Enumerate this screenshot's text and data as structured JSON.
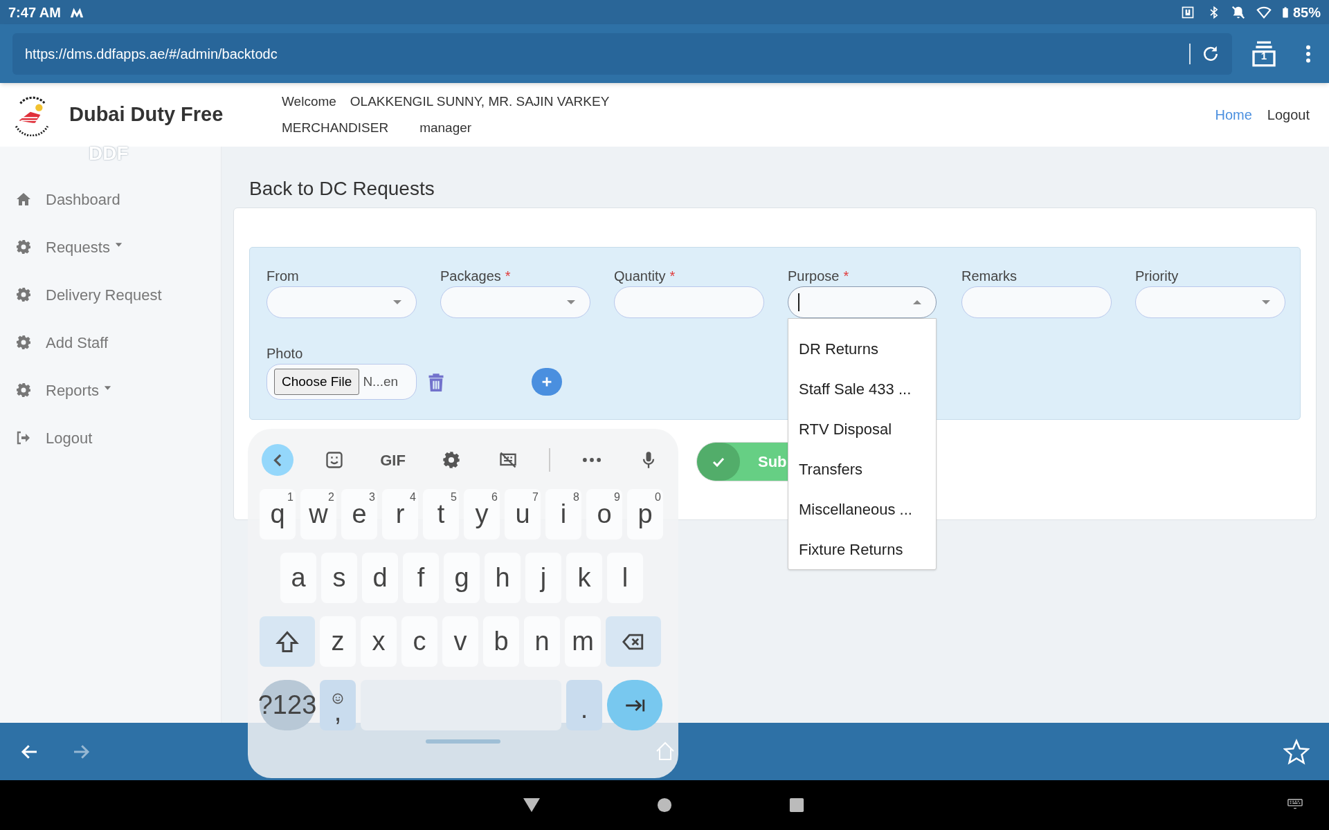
{
  "status_bar": {
    "time": "7:47 AM",
    "battery": "85%"
  },
  "browser": {
    "url": "https://dms.ddfapps.ae/#/admin/backtodc",
    "tab_count": "1"
  },
  "header": {
    "brand": "Dubai Duty Free",
    "brand_caption": "DDF",
    "welcome_label": "Welcome",
    "user_name": "OLAKKENGIL SUNNY, MR. SAJIN VARKEY",
    "role": "MERCHANDISER",
    "user_type": "manager",
    "nav": [
      {
        "label": "Home",
        "selected": true
      },
      {
        "label": "Logout",
        "selected": false
      }
    ]
  },
  "sidebar": {
    "items": [
      {
        "label": "Dashboard",
        "kind": "home",
        "has_submenu": false
      },
      {
        "label": "Requests",
        "kind": "gear",
        "has_submenu": true
      },
      {
        "label": "Delivery Request",
        "kind": "gear",
        "has_submenu": false
      },
      {
        "label": "Add Staff",
        "kind": "gear",
        "has_submenu": false
      },
      {
        "label": "Reports",
        "kind": "gear",
        "has_submenu": true
      },
      {
        "label": "Logout",
        "kind": "logout",
        "has_submenu": false
      }
    ]
  },
  "page": {
    "title": "Back to DC Requests"
  },
  "form": {
    "required_mark": "*",
    "fields": [
      {
        "label": "From",
        "required": false,
        "kind": "select",
        "open": false
      },
      {
        "label": "Packages",
        "required": true,
        "kind": "select",
        "open": false
      },
      {
        "label": "Quantity",
        "required": true,
        "kind": "input",
        "open": false
      },
      {
        "label": "Purpose",
        "required": true,
        "kind": "select",
        "open": true,
        "options": [
          "DR Returns",
          "Staff Sale 433 ...",
          "RTV Disposal",
          "Transfers",
          "Miscellaneous ...",
          "Fixture Returns"
        ]
      },
      {
        "label": "Remarks",
        "required": false,
        "kind": "input",
        "open": false
      },
      {
        "label": "Priority",
        "required": false,
        "kind": "select",
        "open": false
      }
    ],
    "photo": {
      "label": "Photo",
      "button": "Choose File",
      "file_name": "N...en"
    },
    "submit": "Sub"
  },
  "keyboard": {
    "toolbar": [
      {
        "kind": "back"
      },
      {
        "kind": "sticker"
      },
      {
        "kind": "gif",
        "label": "GIF"
      },
      {
        "kind": "settings"
      },
      {
        "kind": "floating"
      },
      {
        "kind": "separator"
      },
      {
        "kind": "more"
      },
      {
        "kind": "mic"
      }
    ],
    "rows": [
      {
        "keys": [
          {
            "kind": "letter",
            "label": "q",
            "hint": "1"
          },
          {
            "kind": "letter",
            "label": "w",
            "hint": "2"
          },
          {
            "kind": "letter",
            "label": "e",
            "hint": "3"
          },
          {
            "kind": "letter",
            "label": "r",
            "hint": "4"
          },
          {
            "kind": "letter",
            "label": "t",
            "hint": "5"
          },
          {
            "kind": "letter",
            "label": "y",
            "hint": "6"
          },
          {
            "kind": "letter",
            "label": "u",
            "hint": "7"
          },
          {
            "kind": "letter",
            "label": "i",
            "hint": "8"
          },
          {
            "kind": "letter",
            "label": "o",
            "hint": "9"
          },
          {
            "kind": "letter",
            "label": "p",
            "hint": "0"
          }
        ]
      },
      {
        "keys": [
          {
            "kind": "letter",
            "label": "a"
          },
          {
            "kind": "letter",
            "label": "s"
          },
          {
            "kind": "letter",
            "label": "d"
          },
          {
            "kind": "letter",
            "label": "f"
          },
          {
            "kind": "letter",
            "label": "g"
          },
          {
            "kind": "letter",
            "label": "h"
          },
          {
            "kind": "letter",
            "label": "j"
          },
          {
            "kind": "letter",
            "label": "k"
          },
          {
            "kind": "letter",
            "label": "l"
          }
        ]
      },
      {
        "keys": [
          {
            "kind": "shift"
          },
          {
            "kind": "letter",
            "label": "z"
          },
          {
            "kind": "letter",
            "label": "x"
          },
          {
            "kind": "letter",
            "label": "c"
          },
          {
            "kind": "letter",
            "label": "v"
          },
          {
            "kind": "letter",
            "label": "b"
          },
          {
            "kind": "letter",
            "label": "n"
          },
          {
            "kind": "letter",
            "label": "m"
          },
          {
            "kind": "backspace"
          }
        ]
      },
      {
        "keys": [
          {
            "kind": "symbols",
            "label": "?123"
          },
          {
            "kind": "emoji",
            "label": ","
          },
          {
            "kind": "space"
          },
          {
            "kind": "period",
            "label": "."
          },
          {
            "kind": "enter"
          }
        ]
      }
    ]
  },
  "browser_nav": {
    "back_disabled": false,
    "forward_disabled": true
  }
}
